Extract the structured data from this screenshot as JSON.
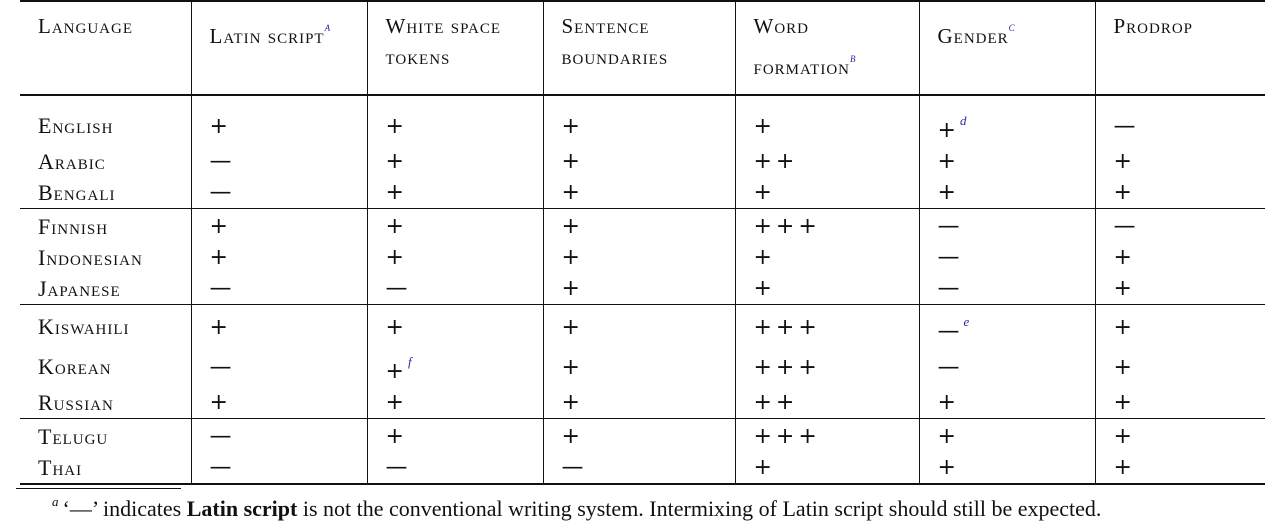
{
  "table": {
    "headers": [
      {
        "text": "Language",
        "note": ""
      },
      {
        "text": "Latin script",
        "note": "a"
      },
      {
        "text": "White space tokens",
        "note": ""
      },
      {
        "text": "Sentence boundaries",
        "note": ""
      },
      {
        "text": "Word formation",
        "note": "b"
      },
      {
        "text": "Gender",
        "note": "c"
      },
      {
        "text": "Prodrop",
        "note": ""
      }
    ],
    "groups": [
      [
        {
          "language": "English",
          "cells": [
            {
              "v": "+",
              "n": ""
            },
            {
              "v": "+",
              "n": ""
            },
            {
              "v": "+",
              "n": ""
            },
            {
              "v": "+",
              "n": ""
            },
            {
              "v": "+",
              "n": "d"
            },
            {
              "v": "—",
              "n": ""
            }
          ]
        },
        {
          "language": "Arabic",
          "cells": [
            {
              "v": "—",
              "n": ""
            },
            {
              "v": "+",
              "n": ""
            },
            {
              "v": "+",
              "n": ""
            },
            {
              "v": "++",
              "n": ""
            },
            {
              "v": "+",
              "n": ""
            },
            {
              "v": "+",
              "n": ""
            }
          ]
        },
        {
          "language": "Bengali",
          "cells": [
            {
              "v": "—",
              "n": ""
            },
            {
              "v": "+",
              "n": ""
            },
            {
              "v": "+",
              "n": ""
            },
            {
              "v": "+",
              "n": ""
            },
            {
              "v": "+",
              "n": ""
            },
            {
              "v": "+",
              "n": ""
            }
          ]
        }
      ],
      [
        {
          "language": "Finnish",
          "cells": [
            {
              "v": "+",
              "n": ""
            },
            {
              "v": "+",
              "n": ""
            },
            {
              "v": "+",
              "n": ""
            },
            {
              "v": "+++",
              "n": ""
            },
            {
              "v": "—",
              "n": ""
            },
            {
              "v": "—",
              "n": ""
            }
          ]
        },
        {
          "language": "Indonesian",
          "cells": [
            {
              "v": "+",
              "n": ""
            },
            {
              "v": "+",
              "n": ""
            },
            {
              "v": "+",
              "n": ""
            },
            {
              "v": "+",
              "n": ""
            },
            {
              "v": "—",
              "n": ""
            },
            {
              "v": "+",
              "n": ""
            }
          ]
        },
        {
          "language": "Japanese",
          "cells": [
            {
              "v": "—",
              "n": ""
            },
            {
              "v": "—",
              "n": ""
            },
            {
              "v": "+",
              "n": ""
            },
            {
              "v": "+",
              "n": ""
            },
            {
              "v": "—",
              "n": ""
            },
            {
              "v": "+",
              "n": ""
            }
          ]
        }
      ],
      [
        {
          "language": "Kiswahili",
          "cells": [
            {
              "v": "+",
              "n": ""
            },
            {
              "v": "+",
              "n": ""
            },
            {
              "v": "+",
              "n": ""
            },
            {
              "v": "+++",
              "n": ""
            },
            {
              "v": "—",
              "n": "e"
            },
            {
              "v": "+",
              "n": ""
            }
          ]
        },
        {
          "language": "Korean",
          "cells": [
            {
              "v": "—",
              "n": ""
            },
            {
              "v": "+",
              "n": "f"
            },
            {
              "v": "+",
              "n": ""
            },
            {
              "v": "+++",
              "n": ""
            },
            {
              "v": "—",
              "n": ""
            },
            {
              "v": "+",
              "n": ""
            }
          ]
        },
        {
          "language": "Russian",
          "cells": [
            {
              "v": "+",
              "n": ""
            },
            {
              "v": "+",
              "n": ""
            },
            {
              "v": "+",
              "n": ""
            },
            {
              "v": "++",
              "n": ""
            },
            {
              "v": "+",
              "n": ""
            },
            {
              "v": "+",
              "n": ""
            }
          ]
        }
      ],
      [
        {
          "language": "Telugu",
          "cells": [
            {
              "v": "—",
              "n": ""
            },
            {
              "v": "+",
              "n": ""
            },
            {
              "v": "+",
              "n": ""
            },
            {
              "v": "+++",
              "n": ""
            },
            {
              "v": "+",
              "n": ""
            },
            {
              "v": "+",
              "n": ""
            }
          ]
        },
        {
          "language": "Thai",
          "cells": [
            {
              "v": "—",
              "n": ""
            },
            {
              "v": "—",
              "n": ""
            },
            {
              "v": "—",
              "n": ""
            },
            {
              "v": "+",
              "n": ""
            },
            {
              "v": "+",
              "n": ""
            },
            {
              "v": "+",
              "n": ""
            }
          ]
        }
      ]
    ]
  },
  "footnote": {
    "marker": "a",
    "prefix": "‘—’ indicates ",
    "bold": "Latin script",
    "suffix": " is not the conventional writing system. Intermixing of Latin script should still be expected."
  },
  "colors": {
    "footnote_marker": "#2a2aa6",
    "rules": "#111111"
  }
}
